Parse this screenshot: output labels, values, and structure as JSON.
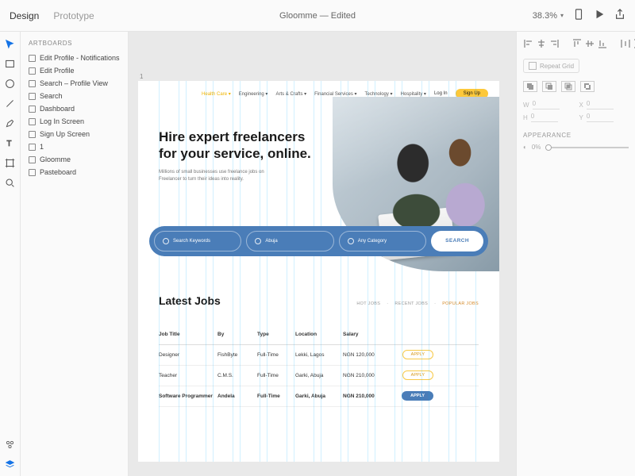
{
  "topbar": {
    "tabs": [
      "Design",
      "Prototype"
    ],
    "active_tab": "Design",
    "doc_title": "Gloomme — Edited",
    "zoom": "38.3%"
  },
  "artboards_panel": {
    "title": "ARTBOARDS",
    "items": [
      "Edit Profile - Notifications",
      "Edit Profile",
      "Search – Profile View",
      "Search",
      "Dashboard",
      "Log In Screen",
      "Sign Up Screen",
      "1",
      "Gloomme",
      "Pasteboard"
    ]
  },
  "canvas": {
    "artboard_label": "1"
  },
  "site": {
    "nav": {
      "links": [
        "Health Care",
        "Engineering",
        "Arts & Crafts",
        "Financial Services",
        "Technology",
        "Hospitality"
      ],
      "active_index": 0,
      "login": "Log In",
      "signup": "Sign Up"
    },
    "hero": {
      "title_line1": "Hire expert freelancers",
      "title_line2": "for your service, online.",
      "subtitle": "Millions of small businesses use freelance jobs on Freelancer to turn their ideas into reality."
    },
    "search": {
      "keywords": "Search Keywords",
      "location": "Abuja",
      "category": "Any Category",
      "button": "SEARCH"
    },
    "jobs": {
      "heading": "Latest Jobs",
      "tabs": [
        "HOT JOBS",
        "RECENT JOBS",
        "POPULAR JOBS"
      ],
      "active_tab_index": 2,
      "columns": [
        "Job Title",
        "By",
        "Type",
        "Location",
        "Salary"
      ],
      "rows": [
        {
          "title": "Designer",
          "by": "FishByte",
          "type": "Full-Time",
          "location": "Lekki, Lagos",
          "salary": "NGN 120,000",
          "apply": "APPLY",
          "highlight": false
        },
        {
          "title": "Teacher",
          "by": "C.M.S.",
          "type": "Full-Time",
          "location": "Garki, Abuja",
          "salary": "NGN 210,000",
          "apply": "APPLY",
          "highlight": false
        },
        {
          "title": "Software Programmer",
          "by": "Andela",
          "type": "Full-Time",
          "location": "Garki, Abuja",
          "salary": "NGN 210,000",
          "apply": "APPLY",
          "highlight": true
        }
      ]
    }
  },
  "inspector": {
    "repeat_grid": "Repeat Grid",
    "dim_labels": {
      "w": "W",
      "x": "X",
      "h": "H",
      "y": "Y"
    },
    "dim_values": {
      "w": "0",
      "x": "0",
      "h": "0",
      "y": "0"
    },
    "appearance_title": "APPEARANCE",
    "opacity": "0%"
  }
}
